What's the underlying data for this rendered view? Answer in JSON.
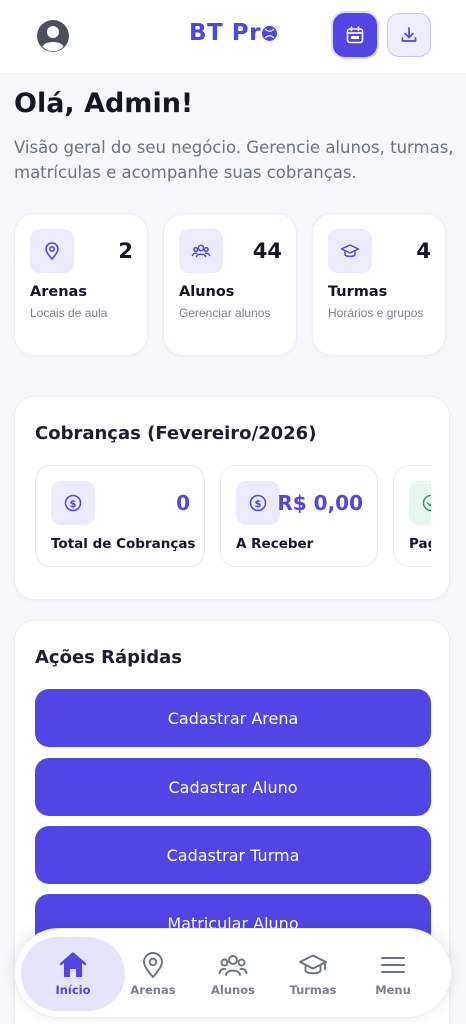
{
  "header": {
    "logo_text": "BT Pr",
    "avatar_icon": "user-circle-icon",
    "calendar_icon": "calendar-icon",
    "download_icon": "download-icon"
  },
  "greeting": "Olá, Admin!",
  "subtitle": "Visão geral do seu negócio. Gerencie alunos, turmas, matrículas e acompanhe suas cobranças.",
  "stats": [
    {
      "icon": "map-pin-icon",
      "value": "2",
      "label": "Arenas",
      "desc": "Locais de aula"
    },
    {
      "icon": "users-icon",
      "value": "44",
      "label": "Alunos",
      "desc": "Gerenciar alunos"
    },
    {
      "icon": "graduation-cap-icon",
      "value": "4",
      "label": "Turmas",
      "desc": "Horários e grupos"
    }
  ],
  "billing": {
    "title": "Cobranças (Fevereiro/2026)",
    "cards": [
      {
        "icon": "dollar-circle-icon",
        "value": "0",
        "label": "Total de Cobranças"
      },
      {
        "icon": "dollar-circle-icon",
        "value": "R$ 0,00",
        "label": "A Receber"
      },
      {
        "icon": "check-circle-icon",
        "value": "",
        "label": "Pag"
      }
    ]
  },
  "quick_actions": {
    "title": "Ações Rápidas",
    "buttons": [
      "Cadastrar Arena",
      "Cadastrar Aluno",
      "Cadastrar Turma",
      "Matricular Aluno"
    ]
  },
  "nav": [
    {
      "icon": "home-icon",
      "label": "Início",
      "active": true
    },
    {
      "icon": "map-pin-icon",
      "label": "Arenas"
    },
    {
      "icon": "users-icon",
      "label": "Alunos"
    },
    {
      "icon": "graduation-cap-icon",
      "label": "Turmas"
    },
    {
      "icon": "menu-icon",
      "label": "Menu"
    }
  ],
  "colors": {
    "primary": "#5046e5",
    "icon_bg": "#ecebfd",
    "background": "#f7f7fb"
  }
}
